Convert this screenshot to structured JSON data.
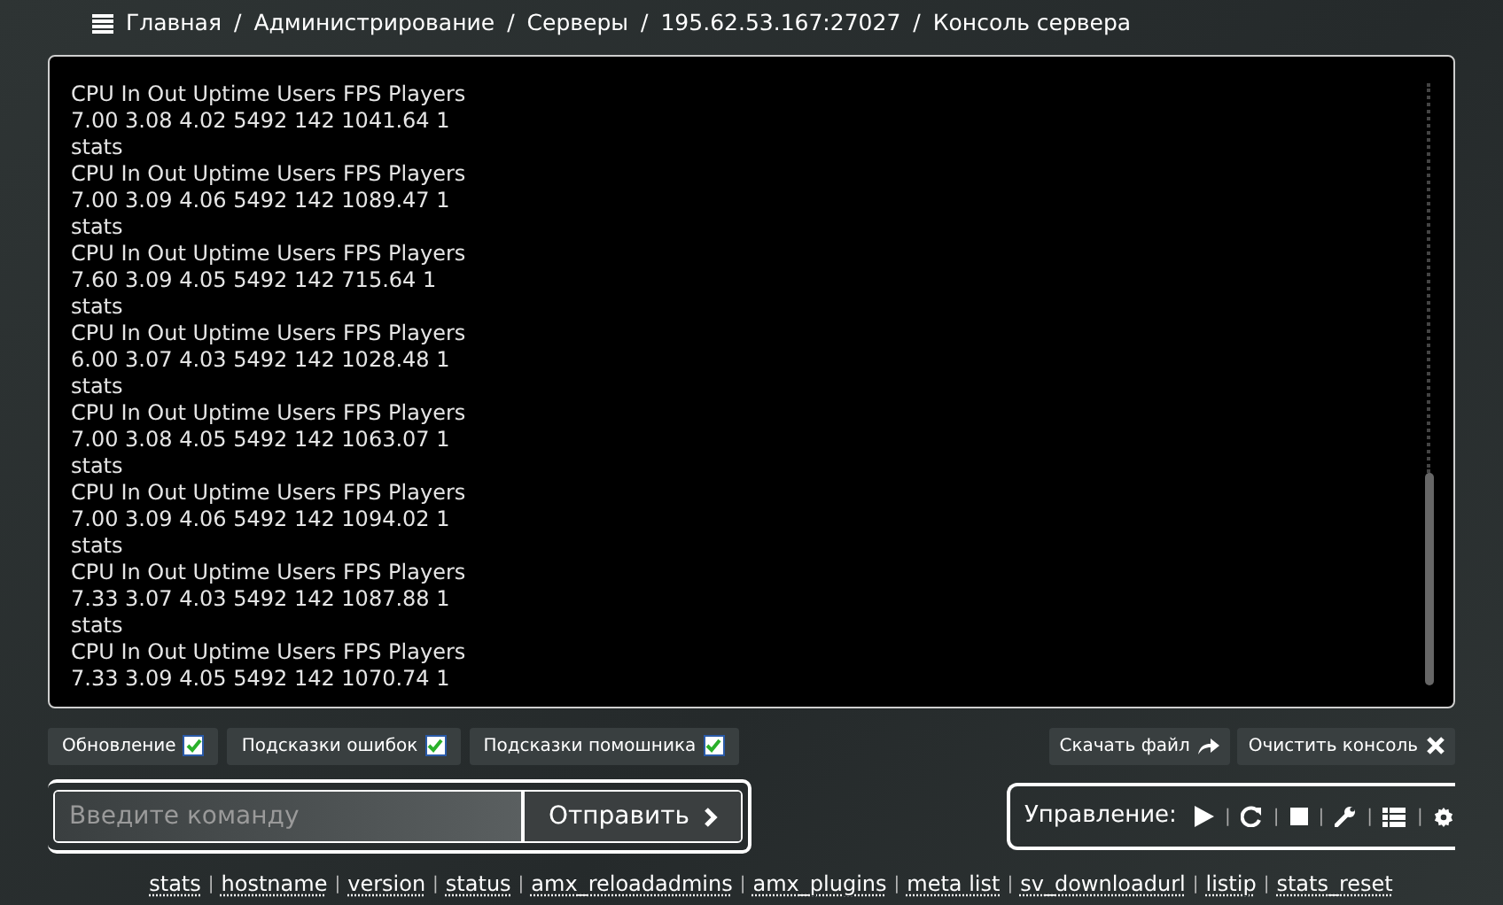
{
  "breadcrumb": {
    "separator": "/",
    "items": [
      {
        "label": "Главная"
      },
      {
        "label": "Администрирование"
      },
      {
        "label": "Серверы"
      },
      {
        "label": "195.62.53.167:27027"
      },
      {
        "label": "Консоль сервера"
      }
    ]
  },
  "console": {
    "lines": [
      "CPU In Out Uptime Users FPS Players",
      "7.00 3.08 4.02 5492 142 1041.64 1",
      "stats",
      "CPU In Out Uptime Users FPS Players",
      "7.00 3.09 4.06 5492 142 1089.47 1",
      "stats",
      "CPU In Out Uptime Users FPS Players",
      "7.60 3.09 4.05 5492 142 715.64 1",
      "stats",
      "CPU In Out Uptime Users FPS Players",
      "6.00 3.07 4.03 5492 142 1028.48 1",
      "stats",
      "CPU In Out Uptime Users FPS Players",
      "7.00 3.08 4.05 5492 142 1063.07 1",
      "stats",
      "CPU In Out Uptime Users FPS Players",
      "7.00 3.09 4.06 5492 142 1094.02 1",
      "stats",
      "CPU In Out Uptime Users FPS Players",
      "7.33 3.07 4.03 5492 142 1087.88 1",
      "stats",
      "CPU In Out Uptime Users FPS Players",
      "7.33 3.09 4.05 5492 142 1070.74 1"
    ]
  },
  "options": [
    {
      "label": "Обновление",
      "checked": true
    },
    {
      "label": "Подсказки ошибок",
      "checked": true
    },
    {
      "label": "Подсказки помошника",
      "checked": true
    }
  ],
  "actions": [
    {
      "label": "Скачать файл",
      "kind": "download"
    },
    {
      "label": "Очистить консоль",
      "kind": "clear"
    }
  ],
  "command": {
    "placeholder": "Введите команду",
    "submit": "Отправить"
  },
  "controls": {
    "label": "Управление:",
    "separator": "|",
    "buttons": [
      {
        "kind": "start"
      },
      {
        "kind": "restart"
      },
      {
        "kind": "stop"
      },
      {
        "kind": "settings"
      },
      {
        "kind": "list"
      },
      {
        "kind": "config"
      }
    ]
  },
  "quick_commands": {
    "separator": "|",
    "items": [
      "stats",
      "hostname",
      "version",
      "status",
      "amx_reloadadmins",
      "amx_plugins",
      "meta list",
      "sv_downloadurl",
      "listip",
      "stats_reset"
    ]
  }
}
